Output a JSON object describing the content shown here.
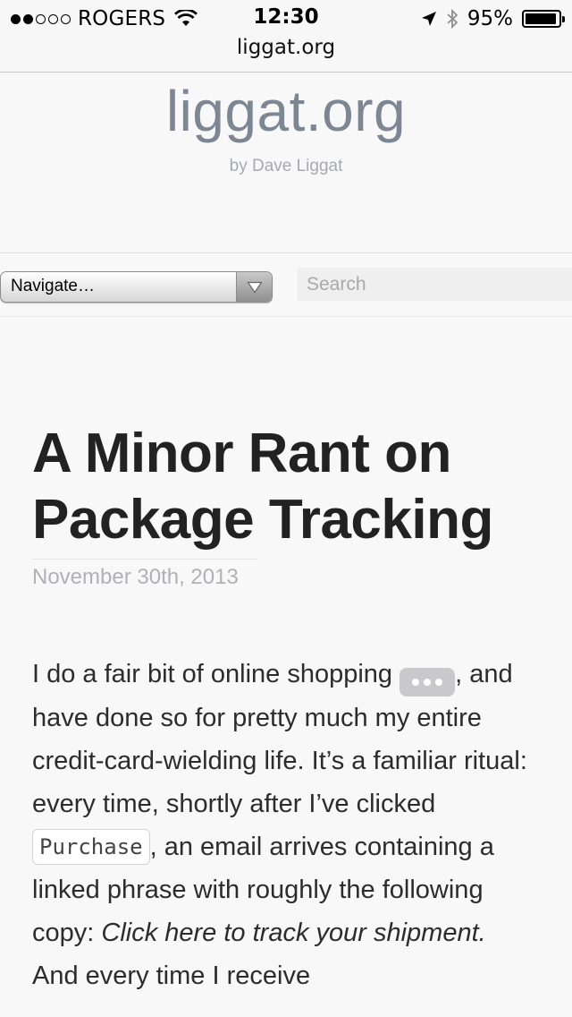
{
  "status_bar": {
    "carrier": "ROGERS",
    "signal_bars_filled": 2,
    "signal_bars_total": 5,
    "time": "12:30",
    "battery_percent_label": "95%",
    "battery_level": 0.95,
    "icons": [
      "wifi-icon",
      "location-arrow-icon",
      "bluetooth-icon",
      "battery-icon"
    ]
  },
  "browser": {
    "url": "liggat.org"
  },
  "site": {
    "title": "liggat.org",
    "byline": "by Dave Liggat"
  },
  "nav": {
    "select_value": "Navigate…",
    "search_placeholder": "Search"
  },
  "post": {
    "title": "A Minor Rant on Package Tracking",
    "date": "November 30th, 2013",
    "body": {
      "p1_a": "I do a fair bit of online shopping ",
      "p1_b": ", and have done so for pretty much my entire credit-card-wielding life. It’s a familiar ritual: every time, shortly after I’ve clicked ",
      "button_label": "Purchase",
      "p1_c": ", an email arrives containing a linked phrase with roughly the following copy: ",
      "link_phrase": "Click here to track your shipment.",
      "p1_d": " And every time I receive"
    }
  },
  "colors": {
    "page_bg": "#f8f8f9",
    "site_title": "#7d8793",
    "byline": "#a7a9ad",
    "date": "#b0b1b4",
    "text": "#2c2c2c"
  }
}
